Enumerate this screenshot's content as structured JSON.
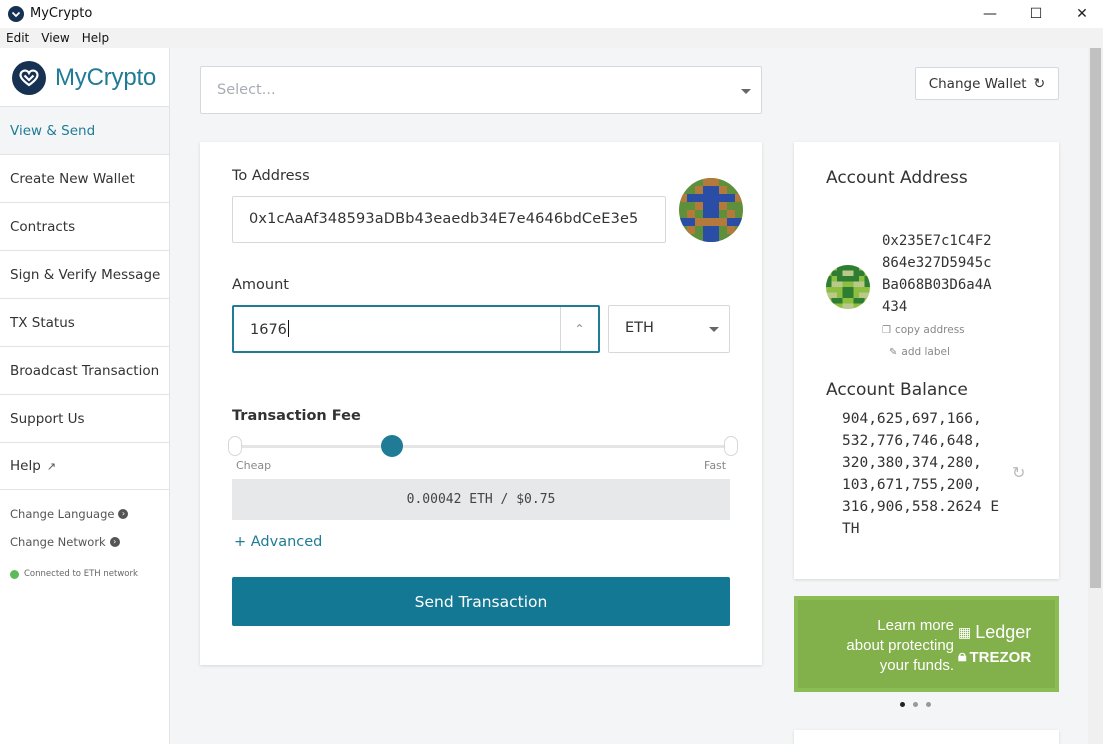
{
  "window": {
    "title": "MyCrypto",
    "controls": {
      "minimize": "—",
      "maximize": "☐",
      "close": "✕"
    }
  },
  "menu": [
    "Edit",
    "View",
    "Help"
  ],
  "sidebar": {
    "logo_text": "MyCrypto",
    "items": [
      {
        "label": "View & Send",
        "active": true
      },
      {
        "label": "Create New Wallet"
      },
      {
        "label": "Contracts"
      },
      {
        "label": "Sign & Verify Message"
      },
      {
        "label": "TX Status"
      },
      {
        "label": "Broadcast Transaction"
      },
      {
        "label": "Support Us"
      },
      {
        "label": "Help"
      }
    ],
    "change_language": "Change Language",
    "change_network": "Change Network",
    "network_status": "Connected to ETH network",
    "status_color": "#5dba5a"
  },
  "header": {
    "select_placeholder": "Select...",
    "change_wallet_label": "Change Wallet"
  },
  "form": {
    "to_label": "To Address",
    "to_value": "0x1cAaAf348593aDBb43eaedb34E7e4646bdCeE3e5",
    "amount_label": "Amount",
    "amount_value": "1676",
    "unit": "ETH",
    "fee_title": "Transaction Fee",
    "fee_cheap": "Cheap",
    "fee_fast": "Fast",
    "fee_position": 0.3,
    "fee_display": "0.00042 ETH / $0.75",
    "advanced_label": "+ Advanced",
    "send_label": "Send Transaction"
  },
  "account": {
    "address_title": "Account Address",
    "address_lines": [
      "0x235E7c1C4F2",
      "864e327D5945c",
      "Ba068B03D6a4A",
      "434"
    ],
    "copy_label": "copy address",
    "add_label": "add label",
    "balance_title": "Account Balance",
    "balance_lines": [
      "904,625,697,166,",
      "532,776,746,648,",
      "320,380,374,280,",
      "103,671,755,200,",
      "316,906,558.2624 E",
      "TH"
    ]
  },
  "promo": {
    "text": [
      "Learn more",
      "about protecting",
      "your funds."
    ],
    "brand_1": "Ledger",
    "brand_2": "TREZOR"
  },
  "colors": {
    "accent": "#1f7b96",
    "brand_dark": "#163151",
    "promo_green": "#82b04b"
  }
}
